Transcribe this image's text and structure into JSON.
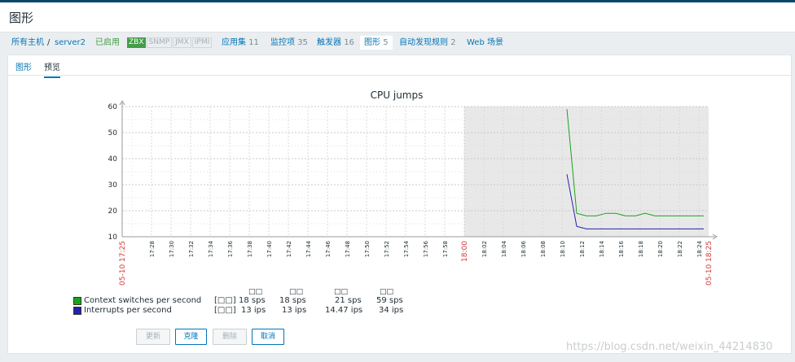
{
  "page": {
    "title": "图形"
  },
  "breadcrumb": {
    "all_hosts": "所有主机",
    "sep": "/",
    "host": "server2",
    "status": "已启用",
    "availability": [
      "ZBX",
      "SNMP",
      "JMX",
      "IPMI"
    ],
    "applications": {
      "label": "应用集",
      "count": "11"
    },
    "items": {
      "label": "监控项",
      "count": "35"
    },
    "triggers": {
      "label": "触发器",
      "count": "16"
    },
    "graphs": {
      "label": "图形",
      "count": "5"
    },
    "discovery": {
      "label": "自动发现规则",
      "count": "2"
    },
    "web": "Web 场景"
  },
  "tabs": [
    {
      "label": "图形"
    },
    {
      "label": "预览"
    }
  ],
  "chart_data": {
    "type": "line",
    "title": "CPU jumps",
    "ylim": [
      10,
      60
    ],
    "yticks": [
      "60",
      "50",
      "40",
      "30",
      "20",
      "10"
    ],
    "xlim_minutes": [
      0,
      60
    ],
    "time_start_label": "05-10 17:25",
    "time_end_label": "05-10 18:25",
    "xticks": [
      "17:28",
      "17:30",
      "17:32",
      "17:34",
      "17:36",
      "17:38",
      "17:40",
      "17:42",
      "17:44",
      "17:46",
      "17:48",
      "17:50",
      "17:52",
      "17:54",
      "17:56",
      "17:58",
      "18:00",
      "18:02",
      "18:04",
      "18:06",
      "18:08",
      "18:10",
      "18:12",
      "18:14",
      "18:16",
      "18:18",
      "18:20",
      "18:22",
      "18:24"
    ],
    "highlight_tick": "18:00",
    "grid": true,
    "no_data_shading_from_minutes": 35,
    "series": [
      {
        "name": "Context switches per second",
        "color": "#1aa31a",
        "x": [
          45.5,
          46.5,
          47.5,
          48.5,
          49.5,
          50.5,
          51.5,
          52.5,
          53.5,
          54.5,
          55.5,
          56.5,
          57.5,
          58.5,
          59.5
        ],
        "y": [
          59,
          19,
          18,
          18,
          19,
          19,
          18,
          18,
          19,
          18,
          18,
          18,
          18,
          18,
          18
        ]
      },
      {
        "name": "Interrupts per second",
        "color": "#2222aa",
        "x": [
          45.5,
          46.5,
          47.5,
          48.5,
          49.5,
          50.5,
          51.5,
          52.5,
          53.5,
          54.5,
          55.5,
          56.5,
          57.5,
          58.5,
          59.5
        ],
        "y": [
          34,
          14,
          13,
          13,
          13,
          13,
          13,
          13,
          13,
          13,
          13,
          13,
          13,
          13,
          13
        ]
      }
    ]
  },
  "legend": {
    "headers": [
      "□□",
      "□□",
      "□□",
      "□□"
    ],
    "rows": [
      {
        "name": "Context switches per second",
        "func": "[□□]",
        "last": "18 sps",
        "min": "18 sps",
        "avg": "21 sps",
        "max": "59 sps",
        "color": "#1aa31a"
      },
      {
        "name": "Interrupts per second",
        "func": "[□□]",
        "last": "13 ips",
        "min": "13 ips",
        "avg": "14.47 ips",
        "max": "34 ips",
        "color": "#2222aa"
      }
    ]
  },
  "buttons": {
    "update": "更新",
    "clone": "克隆",
    "delete": "删除",
    "cancel": "取消"
  },
  "watermark": "https://blog.csdn.net/weixin_44214830"
}
